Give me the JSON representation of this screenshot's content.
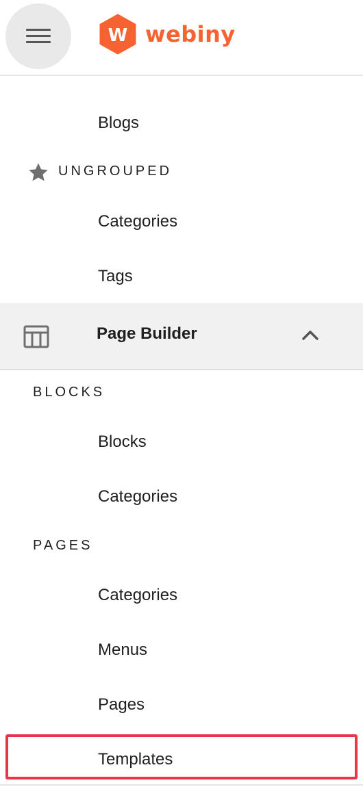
{
  "header": {
    "menu_icon": "hamburger-icon",
    "logo_text": "webiny",
    "logo_mark": "W",
    "brand_color": "#f76232"
  },
  "nav": {
    "blogs": "Blogs",
    "ungrouped": {
      "label": "UNGROUPED",
      "icon": "star-icon",
      "items": [
        "Categories",
        "Tags"
      ]
    },
    "page_builder": {
      "label": "Page Builder",
      "icon": "table-layout-icon",
      "toggle_icon": "chevron-up-icon",
      "blocks": {
        "label": "BLOCKS",
        "items": [
          "Blocks",
          "Categories"
        ]
      },
      "pages": {
        "label": "PAGES",
        "items": [
          "Categories",
          "Menus",
          "Pages",
          "Templates"
        ]
      }
    }
  },
  "highlight_color": "#e8354a"
}
